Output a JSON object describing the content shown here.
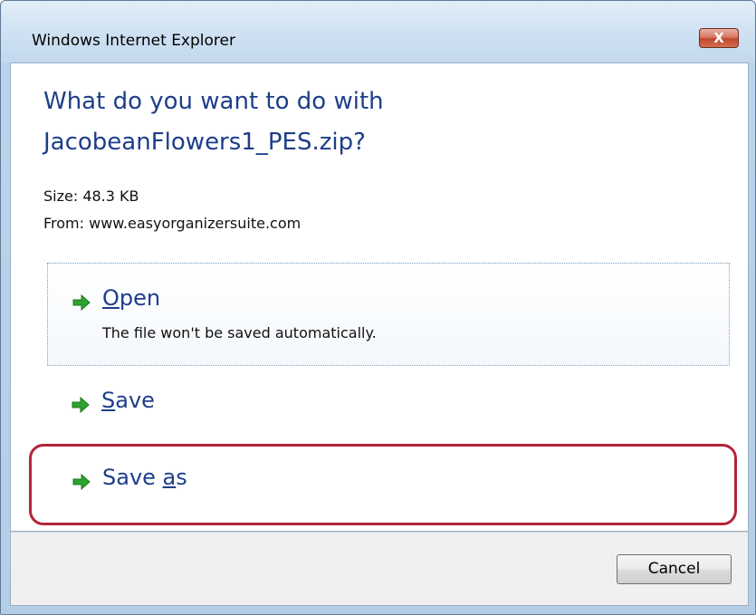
{
  "window": {
    "title": "Windows Internet Explorer",
    "close_glyph": "X"
  },
  "dialog": {
    "question_line1": "What do you want to do with",
    "question_line2": "JacobeanFlowers1_PES.zip?",
    "size_text": "Size: 48.3 KB",
    "from_text": "From: www.easyorganizersuite.com"
  },
  "options": [
    {
      "label_prefix": "",
      "label_underlined": "O",
      "label_suffix": "pen",
      "description": "The file won't be saved automatically.",
      "icon": "green-arrow-icon"
    },
    {
      "label_prefix": "",
      "label_underlined": "S",
      "label_suffix": "ave",
      "description": "",
      "icon": "green-arrow-icon"
    },
    {
      "label_prefix": "Save ",
      "label_underlined": "a",
      "label_suffix": "s",
      "description": "",
      "icon": "green-arrow-icon"
    }
  ],
  "footer": {
    "cancel_label": "Cancel"
  },
  "colors": {
    "heading": "#1e3e8a",
    "arrow_green": "#2ea12e",
    "highlight_red": "#b3243a"
  }
}
